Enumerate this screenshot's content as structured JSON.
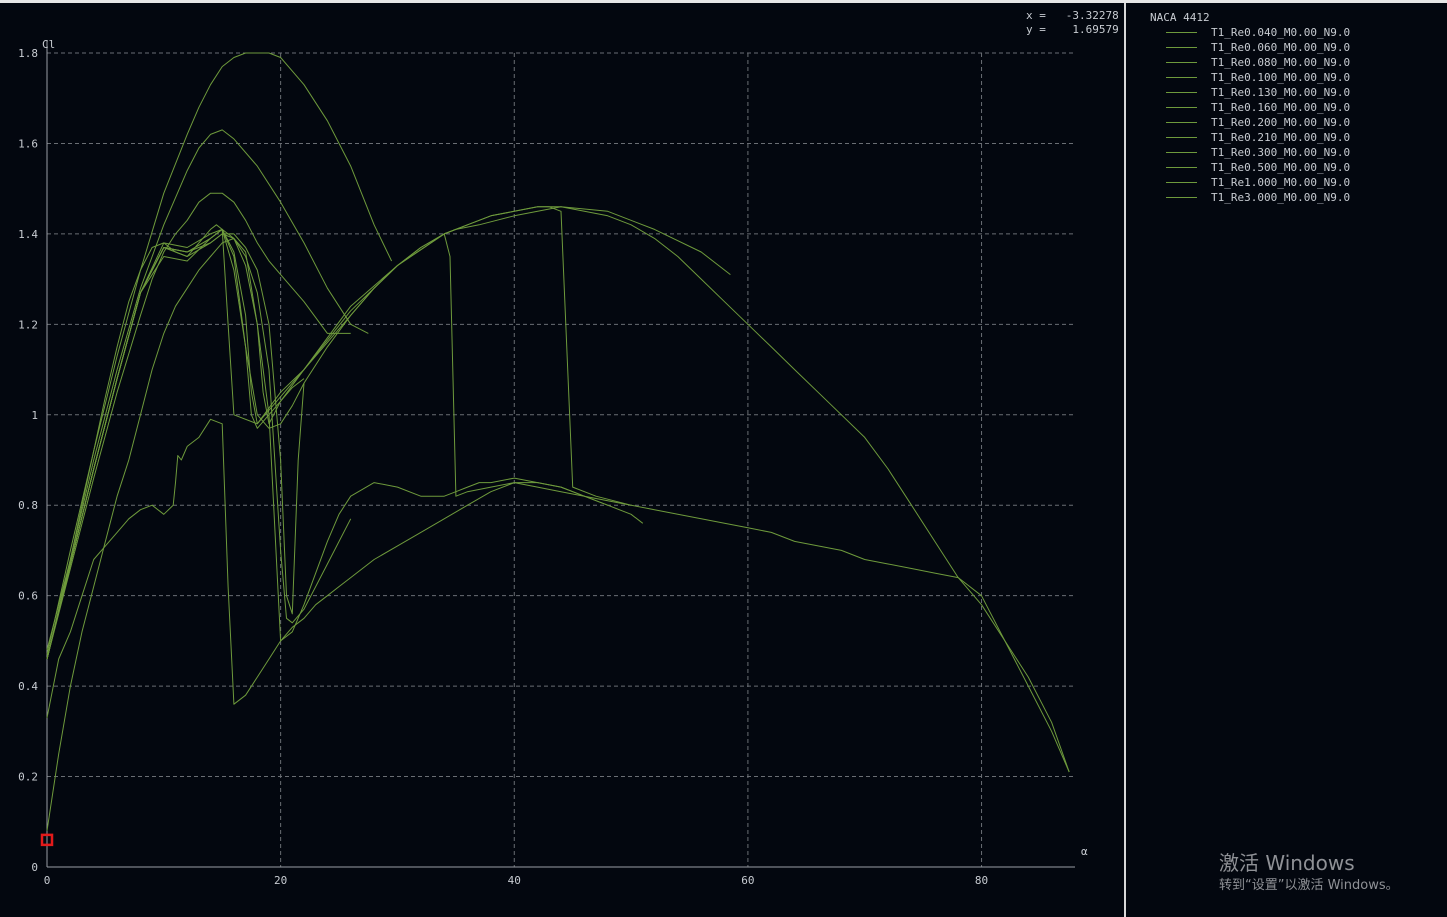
{
  "readout": {
    "x_label": "x",
    "x_value": "-3.32278",
    "y_label": "y",
    "y_value": "1.69579"
  },
  "legend": {
    "title": "NACA 4412",
    "items": [
      "T1_Re0.040_M0.00_N9.0",
      "T1_Re0.060_M0.00_N9.0",
      "T1_Re0.080_M0.00_N9.0",
      "T1_Re0.100_M0.00_N9.0",
      "T1_Re0.130_M0.00_N9.0",
      "T1_Re0.160_M0.00_N9.0",
      "T1_Re0.200_M0.00_N9.0",
      "T1_Re0.210_M0.00_N9.0",
      "T1_Re0.300_M0.00_N9.0",
      "T1_Re0.500_M0.00_N9.0",
      "T1_Re1.000_M0.00_N9.0",
      "T1_Re3.000_M0.00_N9.0"
    ]
  },
  "watermark": {
    "title": "激活 Windows",
    "subtitle": "转到“设置”以激活 Windows。"
  },
  "colors": {
    "background": "#03070f",
    "curve": "#6e9a3c",
    "grid": "#6a6e74",
    "axis": "#9a9ea4",
    "marker": "#e21a1a"
  },
  "chart_data": {
    "type": "line",
    "xlabel": "α",
    "ylabel": "Cl",
    "xlim": [
      0,
      88
    ],
    "ylim": [
      0,
      1.8
    ],
    "xticks": [
      0,
      20,
      40,
      60,
      80
    ],
    "yticks": [
      0,
      0.2,
      0.4,
      0.6,
      0.8,
      1.0,
      1.2,
      1.4,
      1.6,
      1.8
    ],
    "grid": true,
    "legend_position": "right-panel",
    "marker": {
      "x": 0,
      "y": 0.06
    },
    "series": [
      {
        "x": [
          0,
          1,
          2,
          3,
          4,
          5,
          6,
          7,
          8,
          9,
          10,
          10.8,
          11,
          11.2,
          11.5,
          12,
          13,
          14,
          15,
          15.5,
          16,
          17,
          18,
          19,
          20,
          21,
          22,
          23,
          24,
          25,
          26,
          28,
          30,
          32,
          34,
          36,
          38,
          40,
          42,
          44,
          46,
          48,
          50,
          52,
          54,
          56,
          58,
          60,
          62,
          64,
          66,
          68,
          70,
          72,
          74,
          76,
          78,
          80,
          82,
          84,
          86,
          87.5
        ],
        "y": [
          0.33,
          0.46,
          0.52,
          0.6,
          0.68,
          0.71,
          0.74,
          0.77,
          0.79,
          0.8,
          0.78,
          0.8,
          0.85,
          0.91,
          0.9,
          0.93,
          0.95,
          0.99,
          0.98,
          0.62,
          0.36,
          0.38,
          0.42,
          0.46,
          0.5,
          0.53,
          0.55,
          0.58,
          0.6,
          0.62,
          0.64,
          0.68,
          0.71,
          0.74,
          0.77,
          0.8,
          0.83,
          0.85,
          0.84,
          0.83,
          0.82,
          0.81,
          0.8,
          0.79,
          0.78,
          0.77,
          0.76,
          0.75,
          0.74,
          0.72,
          0.71,
          0.7,
          0.68,
          0.67,
          0.66,
          0.65,
          0.64,
          0.6,
          0.5,
          0.4,
          0.3,
          0.21
        ]
      },
      {
        "x": [
          0,
          1,
          2,
          3,
          4,
          5,
          6,
          7,
          8,
          9,
          10,
          11,
          12,
          13,
          14,
          15,
          16,
          17,
          18,
          19,
          19.5,
          20,
          21,
          22,
          23,
          24,
          25,
          26,
          28,
          30,
          32,
          34,
          35,
          36,
          37,
          38,
          40,
          42,
          44,
          46,
          48,
          50,
          51
        ],
        "y": [
          0.08,
          0.25,
          0.4,
          0.52,
          0.62,
          0.72,
          0.82,
          0.9,
          1.0,
          1.1,
          1.18,
          1.24,
          1.28,
          1.32,
          1.35,
          1.38,
          1.39,
          1.36,
          1.2,
          1.0,
          0.75,
          0.5,
          0.52,
          0.58,
          0.65,
          0.72,
          0.78,
          0.82,
          0.85,
          0.84,
          0.82,
          0.82,
          0.83,
          0.84,
          0.85,
          0.85,
          0.86,
          0.85,
          0.84,
          0.82,
          0.8,
          0.78,
          0.76
        ]
      },
      {
        "x": [
          0,
          1,
          2,
          3,
          4,
          5,
          6,
          7,
          8,
          9,
          10,
          11,
          12,
          13,
          14,
          14.5,
          15,
          16,
          17,
          18,
          19,
          20,
          21,
          22,
          24,
          26,
          28,
          30,
          32,
          34,
          35,
          37,
          40,
          44,
          48,
          52,
          56,
          58.5
        ],
        "y": [
          0.48,
          0.58,
          0.68,
          0.8,
          0.92,
          1.04,
          1.15,
          1.25,
          1.32,
          1.37,
          1.38,
          1.36,
          1.35,
          1.38,
          1.41,
          1.42,
          1.41,
          1.32,
          1.15,
          1.0,
          0.97,
          0.98,
          1.02,
          1.07,
          1.15,
          1.22,
          1.28,
          1.33,
          1.37,
          1.4,
          1.41,
          1.42,
          1.44,
          1.46,
          1.45,
          1.41,
          1.36,
          1.31
        ]
      },
      {
        "x": [
          0,
          2,
          4,
          6,
          8,
          9,
          10,
          11,
          12,
          13,
          14,
          15,
          16,
          17,
          18,
          19,
          20,
          22,
          24,
          26
        ],
        "y": [
          0.46,
          0.66,
          0.86,
          1.05,
          1.22,
          1.3,
          1.36,
          1.4,
          1.43,
          1.47,
          1.49,
          1.49,
          1.47,
          1.43,
          1.38,
          1.34,
          1.31,
          1.25,
          1.18,
          1.18
        ]
      },
      {
        "x": [
          0,
          2,
          4,
          6,
          8,
          10,
          12,
          13,
          14,
          15,
          16,
          18,
          20,
          22,
          24,
          26,
          27.5
        ],
        "y": [
          0.46,
          0.68,
          0.9,
          1.1,
          1.28,
          1.42,
          1.54,
          1.59,
          1.62,
          1.63,
          1.61,
          1.55,
          1.47,
          1.38,
          1.28,
          1.2,
          1.18
        ]
      },
      {
        "x": [
          0,
          2,
          4,
          6,
          8,
          10,
          12,
          13,
          14,
          15,
          16,
          17,
          18,
          19,
          20,
          21,
          22,
          24,
          26,
          28,
          29.5
        ],
        "y": [
          0.47,
          0.7,
          0.92,
          1.13,
          1.32,
          1.49,
          1.62,
          1.68,
          1.73,
          1.77,
          1.79,
          1.8,
          1.8,
          1.8,
          1.79,
          1.76,
          1.73,
          1.65,
          1.55,
          1.42,
          1.34
        ]
      },
      {
        "x": [
          0,
          2,
          4,
          6,
          8,
          10,
          12,
          14,
          15,
          16,
          17,
          18,
          19,
          20,
          20.5,
          21,
          22,
          24,
          26
        ],
        "y": [
          0.46,
          0.67,
          0.88,
          1.08,
          1.27,
          1.35,
          1.34,
          1.39,
          1.41,
          1.39,
          1.35,
          1.27,
          1.1,
          0.7,
          0.55,
          0.54,
          0.57,
          0.67,
          0.77
        ]
      },
      {
        "x": [
          0,
          2,
          4,
          6,
          8,
          10,
          12,
          14,
          15,
          16,
          17,
          18,
          19,
          20,
          20.5,
          21,
          21.5,
          22
        ],
        "y": [
          0.46,
          0.67,
          0.88,
          1.08,
          1.27,
          1.37,
          1.35,
          1.38,
          1.4,
          1.4,
          1.37,
          1.32,
          1.2,
          0.9,
          0.6,
          0.56,
          0.9,
          1.07
        ]
      },
      {
        "x": [
          0,
          2,
          4,
          6,
          8,
          10,
          12,
          14,
          15,
          16,
          17,
          18,
          18.5,
          19,
          20,
          21,
          22
        ],
        "y": [
          0.46,
          0.67,
          0.88,
          1.08,
          1.27,
          1.37,
          1.36,
          1.38,
          1.4,
          1.39,
          1.33,
          1.2,
          1.05,
          0.98,
          1.03,
          1.06,
          1.08
        ]
      },
      {
        "x": [
          0,
          2,
          4,
          6,
          8,
          10,
          12,
          14,
          15,
          16,
          17,
          17.5,
          18,
          20,
          22,
          24,
          26,
          28,
          30,
          32,
          34,
          34.5,
          35,
          36,
          38,
          40,
          42,
          44,
          46,
          48
        ],
        "y": [
          0.46,
          0.67,
          0.88,
          1.08,
          1.27,
          1.37,
          1.36,
          1.39,
          1.41,
          1.35,
          1.15,
          1.0,
          0.97,
          1.03,
          1.1,
          1.16,
          1.22,
          1.28,
          1.33,
          1.37,
          1.4,
          1.35,
          0.82,
          0.83,
          0.84,
          0.85,
          0.85,
          0.84,
          0.82,
          0.8
        ]
      },
      {
        "x": [
          0,
          2,
          4,
          6,
          8,
          10,
          12,
          14,
          15,
          16,
          17,
          17.5,
          18,
          20,
          22,
          26,
          30,
          34,
          36,
          38,
          40,
          42,
          43,
          44,
          45,
          47,
          50
        ],
        "y": [
          0.46,
          0.67,
          0.88,
          1.08,
          1.27,
          1.37,
          1.36,
          1.39,
          1.41,
          1.36,
          1.22,
          1.05,
          0.98,
          1.04,
          1.1,
          1.23,
          1.33,
          1.4,
          1.42,
          1.44,
          1.45,
          1.46,
          1.46,
          1.45,
          0.84,
          0.82,
          0.8
        ]
      },
      {
        "x": [
          0,
          2,
          4,
          6,
          8,
          10,
          12,
          14,
          15,
          15.5,
          16,
          18,
          20,
          22,
          26,
          30,
          34,
          36,
          38,
          40,
          42,
          44,
          46,
          48,
          50,
          52,
          54,
          56,
          58,
          60,
          62,
          64,
          66,
          68,
          70,
          72,
          74,
          76,
          78,
          80,
          82,
          84,
          86,
          87.5
        ],
        "y": [
          0.46,
          0.67,
          0.88,
          1.08,
          1.27,
          1.38,
          1.37,
          1.4,
          1.41,
          1.2,
          1.0,
          0.98,
          1.05,
          1.1,
          1.24,
          1.33,
          1.4,
          1.42,
          1.44,
          1.45,
          1.46,
          1.46,
          1.45,
          1.44,
          1.42,
          1.39,
          1.35,
          1.3,
          1.25,
          1.2,
          1.15,
          1.1,
          1.05,
          1.0,
          0.95,
          0.88,
          0.8,
          0.72,
          0.64,
          0.58,
          0.5,
          0.42,
          0.32,
          0.21
        ]
      }
    ]
  }
}
